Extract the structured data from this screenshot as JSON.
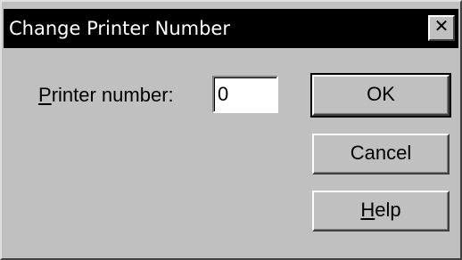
{
  "window": {
    "title": "Change Printer Number",
    "close_label": "✕"
  },
  "form": {
    "label_first": "P",
    "label_rest": "rinter number:",
    "value": "0"
  },
  "buttons": {
    "ok_label": "OK",
    "cancel_label": "Cancel",
    "help_first": "H",
    "help_rest": "elp"
  },
  "colors": {
    "face": "#c0c0c0",
    "titlebar": "#000000",
    "title_text": "#ffffff"
  }
}
